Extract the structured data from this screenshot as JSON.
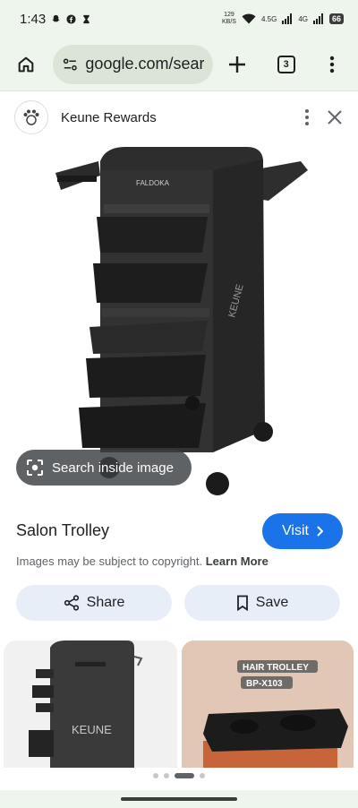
{
  "status_bar": {
    "time": "1:43",
    "net_speed_value": "129",
    "net_speed_unit": "KB/S",
    "signal_1": "4.5G",
    "signal_2": "4G",
    "battery": "66"
  },
  "browser": {
    "url": "google.com/searc",
    "tab_count": "3"
  },
  "sheet": {
    "site_name": "Keune Rewards"
  },
  "image": {
    "search_inside_label": "Search inside image",
    "brand_on_cart": "FALDOKA",
    "brand_on_side": "KEUNE"
  },
  "result": {
    "title": "Salon Trolley",
    "visit_label": "Visit",
    "copyright_text": "Images may be subject to copyright.",
    "learn_more": "Learn More",
    "share_label": "Share",
    "save_label": "Save"
  },
  "related": [
    {
      "brand": "KEUNE"
    },
    {
      "line1": "HAIR TROLLEY",
      "line2": "BP-X103"
    }
  ],
  "colors": {
    "accent": "#1a73e8",
    "chrome_bg": "#eef5ec",
    "chip_bg": "#e8eef8"
  }
}
